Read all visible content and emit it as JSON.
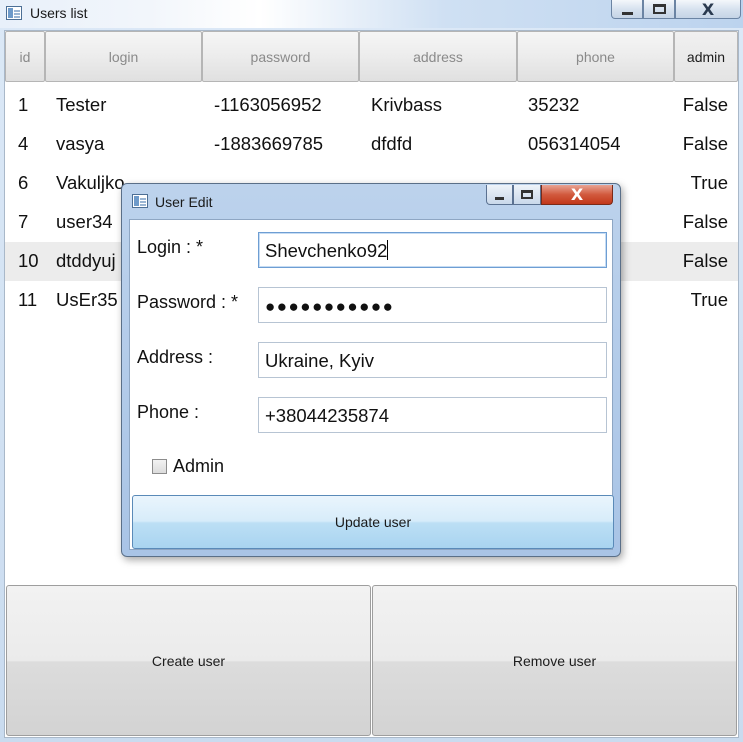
{
  "main_window": {
    "title": "Users list",
    "close_glyph": "X"
  },
  "grid": {
    "columns": [
      "id",
      "login",
      "password",
      "address",
      "phone",
      "admin"
    ],
    "rows": [
      {
        "id": "1",
        "login": "Tester",
        "password": "-1163056952",
        "address": "Krivbass",
        "phone": "35232",
        "admin": "False"
      },
      {
        "id": "4",
        "login": "vasya",
        "password": "-1883669785",
        "address": "dfdfd",
        "phone": "056314054",
        "admin": "False"
      },
      {
        "id": "6",
        "login": "Vakuljko",
        "password": "",
        "address": "",
        "phone": "",
        "admin": "True"
      },
      {
        "id": "7",
        "login": "user34",
        "password": "",
        "address": "",
        "phone": "",
        "admin": "False"
      },
      {
        "id": "10",
        "login": "dtddyuj",
        "password": "",
        "address": "",
        "phone": "",
        "admin": "False"
      },
      {
        "id": "11",
        "login": "UsEr35",
        "password": "",
        "address": "",
        "phone": "",
        "admin": "True"
      }
    ]
  },
  "buttons": {
    "create": "Create user",
    "remove": "Remove user"
  },
  "dialog": {
    "title": "User Edit",
    "close_glyph": "X",
    "login_label": "Login : *",
    "login_value": "Shevchenko92",
    "password_label": "Password : *",
    "password_masked": "●●●●●●●●●●●",
    "address_label": "Address :",
    "address_value": "Ukraine, Kyiv",
    "phone_label": "Phone :",
    "phone_value": "+38044235874",
    "admin_label": "Admin",
    "admin_checked": false,
    "update_button": "Update user"
  }
}
